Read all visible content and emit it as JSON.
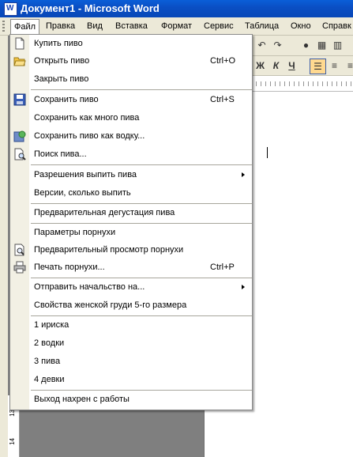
{
  "window": {
    "title": "Документ1 - Microsoft Word",
    "icon_letter": "W"
  },
  "menubar": {
    "items": [
      "Файл",
      "Правка",
      "Вид",
      "Вставка",
      "Формат",
      "Сервис",
      "Таблица",
      "Окно",
      "Справк"
    ],
    "active": "Файл"
  },
  "toolbar": {
    "bold": "Ж",
    "italic": "К",
    "underline": "Ч"
  },
  "file_menu": {
    "groups": [
      [
        {
          "label": "Купить пиво",
          "icon": "new-document-icon"
        },
        {
          "label": "Открыть пиво",
          "shortcut": "Ctrl+O",
          "icon": "open-folder-icon"
        },
        {
          "label": "Закрыть пиво"
        }
      ],
      [
        {
          "label": "Сохранить пиво",
          "shortcut": "Ctrl+S",
          "icon": "floppy-disk-icon"
        },
        {
          "label": "Сохранить как много пива"
        },
        {
          "label": "Сохранить пиво как водку...",
          "icon": "save-as-web-icon"
        },
        {
          "label": "Поиск пива...",
          "icon": "file-search-icon"
        }
      ],
      [
        {
          "label": "Разрешения выпить пива",
          "submenu": true
        },
        {
          "label": "Версии, сколько выпить"
        }
      ],
      [
        {
          "label": "Предварительная дегустация пива"
        }
      ],
      [
        {
          "label": "Параметры порнухи"
        },
        {
          "label": "Предварительный просмотр порнухи",
          "icon": "print-preview-icon"
        },
        {
          "label": "Печать порнухи...",
          "shortcut": "Ctrl+P",
          "icon": "printer-icon"
        }
      ],
      [
        {
          "label": "Отправить начальство на...",
          "submenu": true
        },
        {
          "label": "Свойства женской груди 5-го размера"
        }
      ],
      [
        {
          "label": "1 ириска"
        },
        {
          "label": "2 водки"
        },
        {
          "label": "3 пива"
        },
        {
          "label": "4 девки"
        }
      ],
      [
        {
          "label": "Выход нахрен с работы"
        }
      ]
    ]
  },
  "vertical_ruler": [
    "13",
    "14"
  ]
}
